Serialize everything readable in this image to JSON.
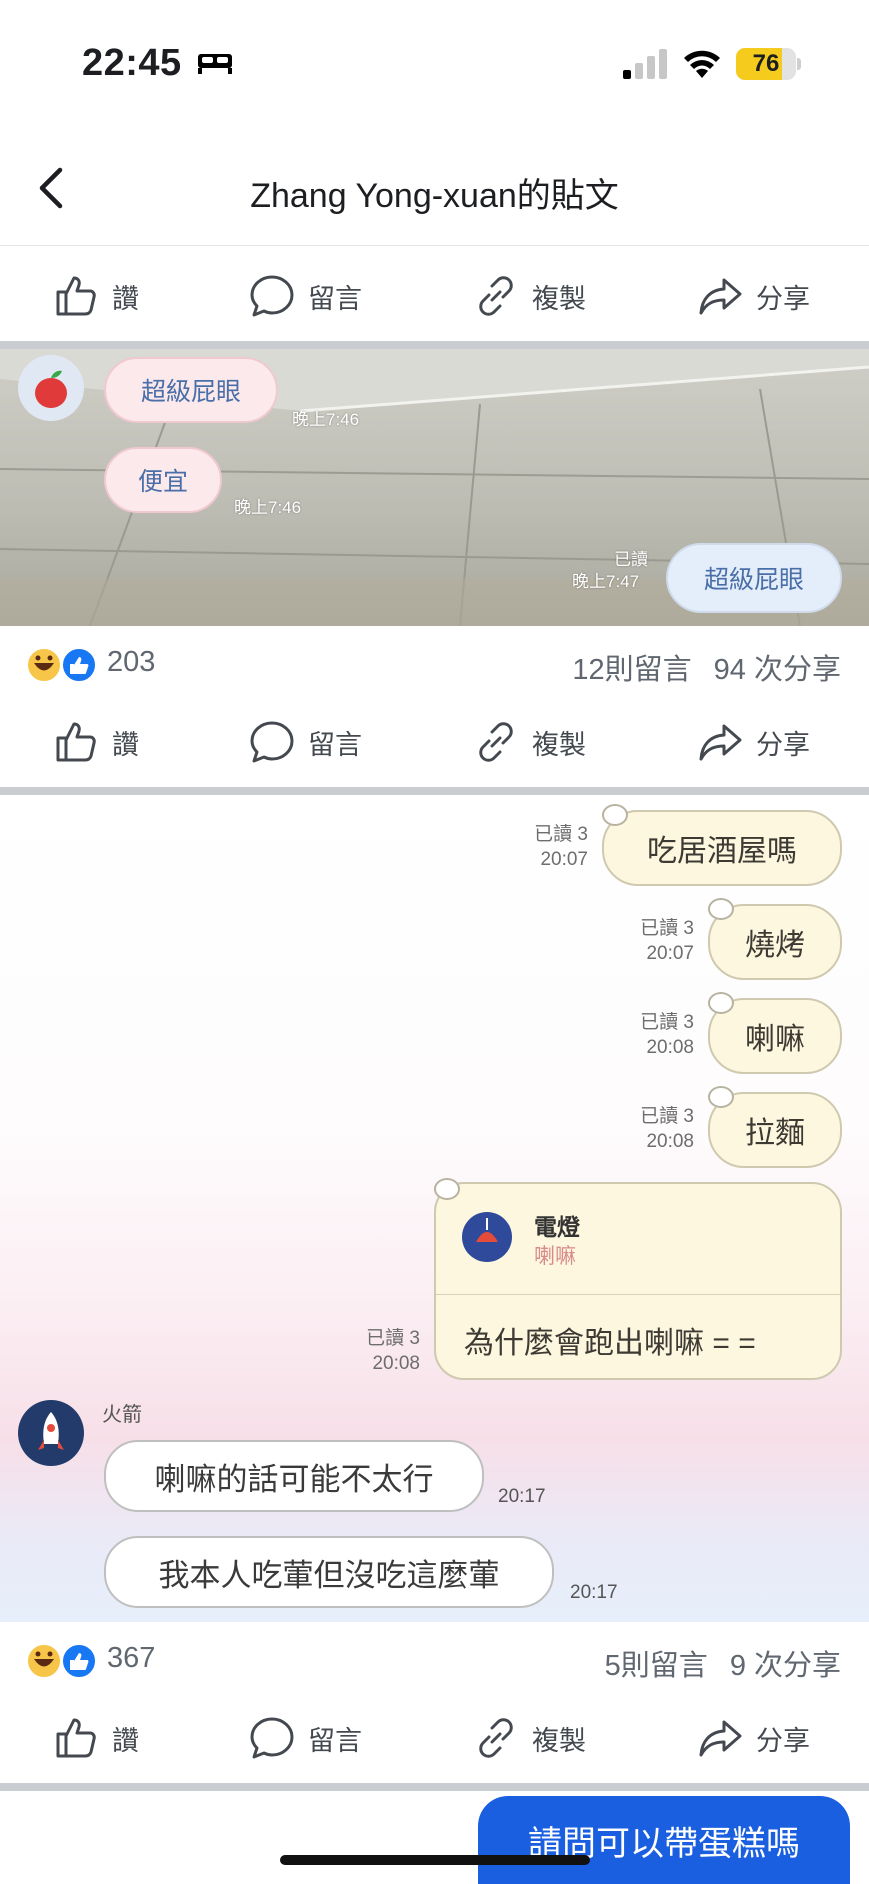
{
  "status_bar": {
    "time": "22:45",
    "battery": "76",
    "battery_level": 0.76
  },
  "header": {
    "title": "Zhang Yong-xuan的貼文"
  },
  "actions": {
    "like": "讚",
    "comment": "留言",
    "copy": "複製",
    "share": "分享"
  },
  "post1": {
    "messages": [
      {
        "text": "超級屁眼",
        "time": "晚上7:46"
      },
      {
        "text": "便宜",
        "time": "晚上7:46"
      },
      {
        "text": "超級屁眼",
        "read": "已讀",
        "time": "晚上7:47"
      }
    ],
    "reactions_count": "203",
    "comments": "12則留言",
    "shares": "94 次分享"
  },
  "post2": {
    "sent": [
      {
        "text": "吃居酒屋嗎",
        "read": "已讀 3",
        "time": "20:07"
      },
      {
        "text": "燒烤",
        "read": "已讀 3",
        "time": "20:07"
      },
      {
        "text": "喇嘛",
        "read": "已讀 3",
        "time": "20:08"
      },
      {
        "text": "拉麵",
        "read": "已讀 3",
        "time": "20:08"
      }
    ],
    "reply_card": {
      "name": "電燈",
      "quoted": "喇嘛",
      "text": "為什麼會跑出喇嘛 = =",
      "read": "已讀 3",
      "time": "20:08"
    },
    "other_user": "火箭",
    "received": [
      {
        "text": "喇嘛的話可能不太行",
        "time": "20:17"
      },
      {
        "text": "我本人吃葷但沒吃這麼葷",
        "time": "20:17"
      }
    ],
    "reactions_count": "367",
    "comments": "5則留言",
    "shares": "9 次分享"
  },
  "next_post": {
    "bubble": "請問可以帶蛋糕嗎"
  },
  "colors": {
    "accent_blue": "#1877f2",
    "cta_blue": "#1a5fe0",
    "battery_yellow": "#f5cc1d"
  }
}
